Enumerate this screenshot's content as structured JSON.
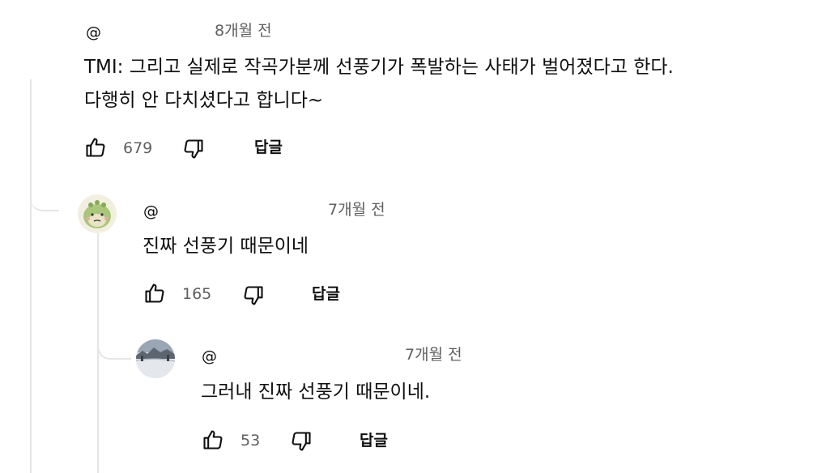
{
  "comments": [
    {
      "author": "@",
      "time": "8개월 전",
      "lines": [
        "TMI: 그리고 실제로 작곡가분께 선풍기가 폭발하는 사태가 벌어졌다고 한다.",
        "다행히 안 다치셨다고 합니다~"
      ],
      "like_icon": "thumbs-up-icon",
      "likes": "679",
      "dislike_icon": "thumbs-down-icon",
      "reply_label": "답글"
    },
    {
      "author": "@",
      "time": "7개월 전",
      "lines": [
        "진짜 선풍기 때문이네"
      ],
      "avatar": "dinosaur-avatar",
      "likes": "165",
      "reply_label": "답글"
    },
    {
      "author": "@",
      "time": "7개월 전",
      "lines": [
        "그러내 진짜 선풍기 때문이네."
      ],
      "avatar": "snowy-landscape-avatar",
      "likes": "53",
      "reply_label": "답글"
    }
  ],
  "colors": {
    "text": "#0f0f0f",
    "secondary": "#606060",
    "thread_line": "#e5e5e5"
  }
}
